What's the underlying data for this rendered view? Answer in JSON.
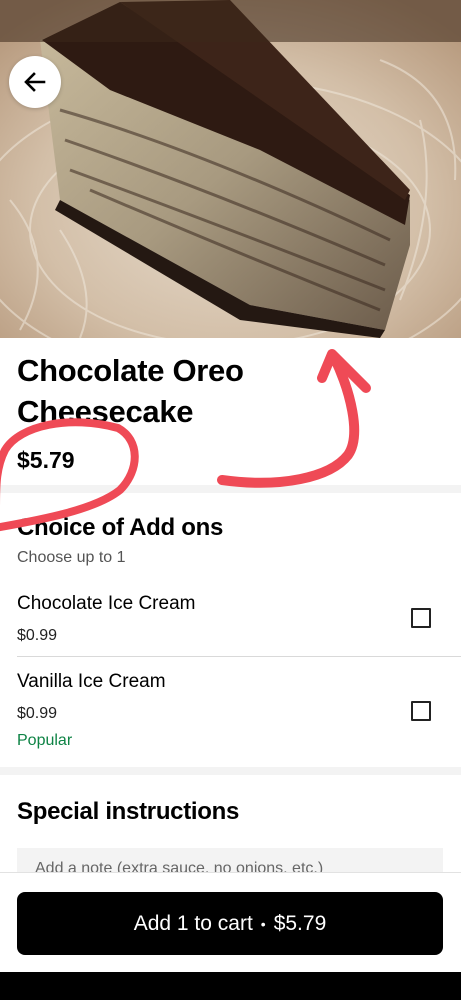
{
  "hero": {
    "image_alt": "Chocolate Oreo Cheesecake slice"
  },
  "back_button": {
    "icon": "arrow-left-icon"
  },
  "item": {
    "title": "Chocolate Oreo Cheesecake",
    "price": "$5.79"
  },
  "addons": {
    "title": "Choice of Add ons",
    "subtitle": "Choose up to 1",
    "options": [
      {
        "name": "Chocolate Ice Cream",
        "price": "$0.99",
        "badge": "",
        "checked": false
      },
      {
        "name": "Vanilla Ice Cream",
        "price": "$0.99",
        "badge": "Popular",
        "checked": false
      }
    ]
  },
  "special_instructions": {
    "title": "Special instructions",
    "placeholder": "Add a note (extra sauce, no onions, etc.)"
  },
  "cart_button": {
    "label": "Add 1 to cart",
    "separator": "•",
    "total": "$5.79"
  },
  "colors": {
    "accent_green": "#0e8345",
    "annotation_red": "#ef4a56",
    "button_black": "#000000"
  }
}
